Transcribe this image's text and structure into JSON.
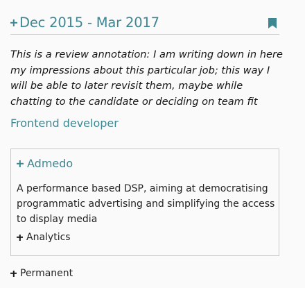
{
  "entry": {
    "period": "Dec 2015 - Mar 2017",
    "annotation": "This is a review annotation: I am writing down in here my impressions about this particular job; this way I will be able to later revisit them, maybe while chatting to the candidate or deciding on team fit",
    "role": "Frontend developer",
    "company": {
      "name": "Admedo",
      "description": "A performance based DSP, aiming at democratising programmatic advertising and simplifying the access to display media",
      "tag": "Analytics"
    },
    "contract": "Permanent",
    "icons": {
      "expand": "plus-icon",
      "bookmark": "bookmark-icon"
    }
  },
  "colors": {
    "accent": "#3d8793",
    "text": "#222222",
    "background": "#fafafa",
    "border": "#c7c7c7"
  }
}
